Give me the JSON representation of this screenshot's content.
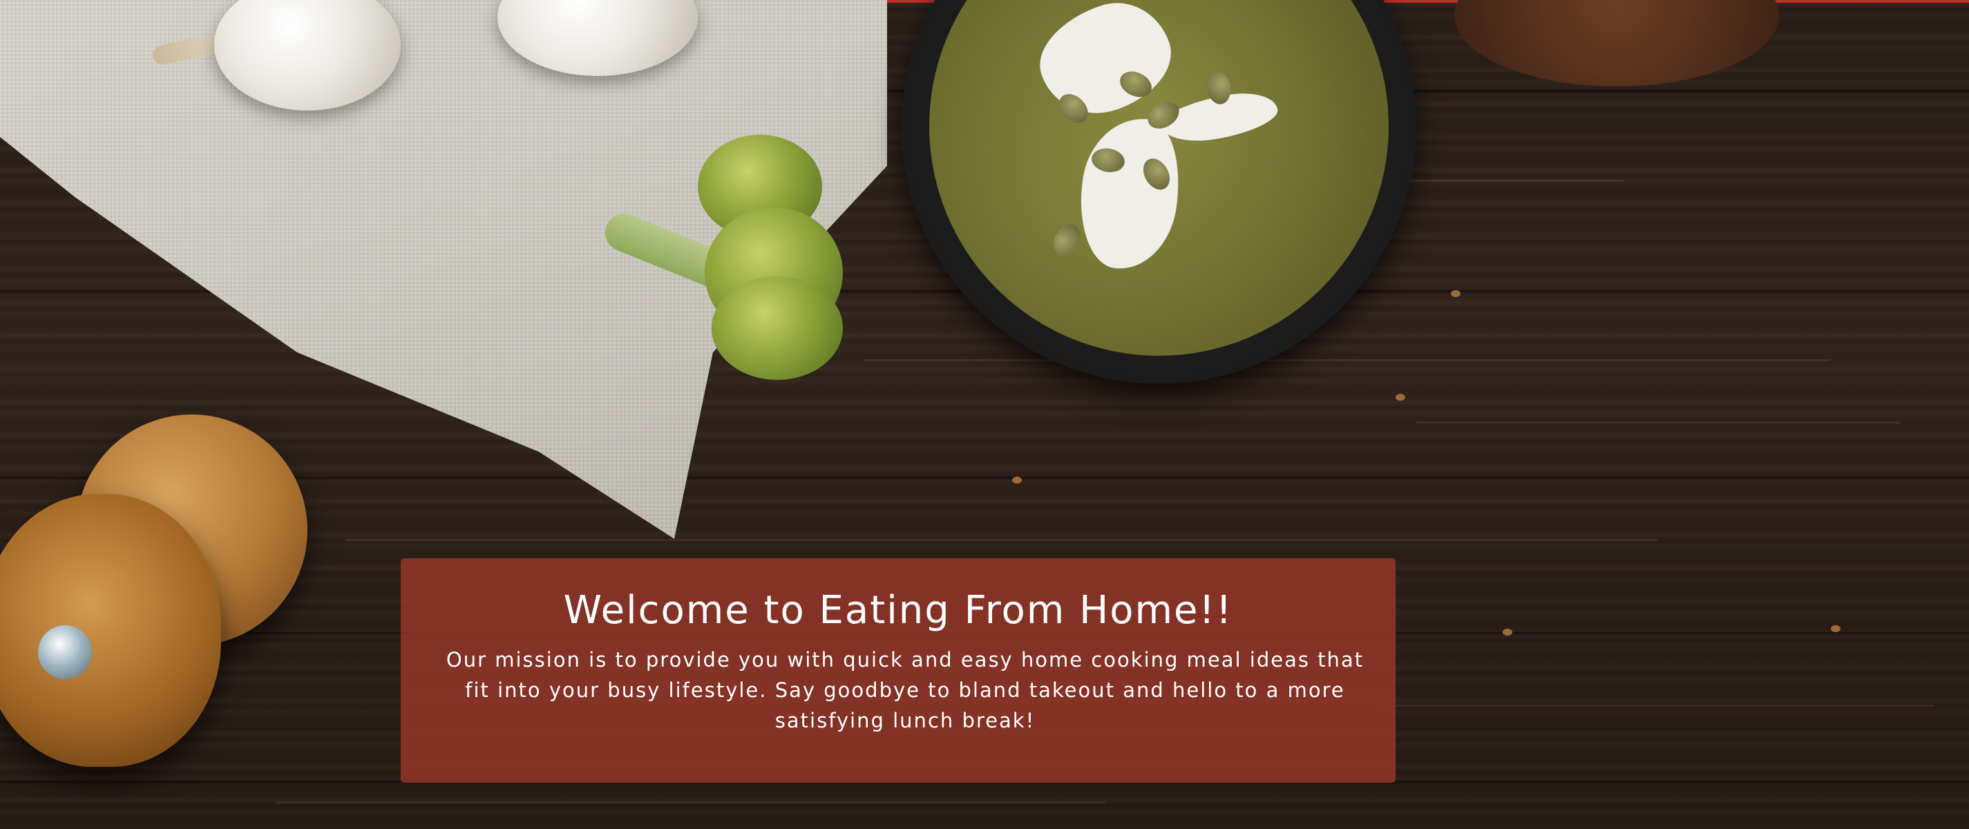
{
  "hero": {
    "title": "Welcome to Eating From Home!!",
    "mission": "Our mission is to provide you with quick and easy home cooking meal ideas that fit into your busy lifestyle. Say goodbye to bland takeout and hello to a more satisfying lunch break!"
  },
  "colors": {
    "banner_background": "#983629",
    "accent_strip": "#b8322a",
    "text": "#ffffff"
  }
}
